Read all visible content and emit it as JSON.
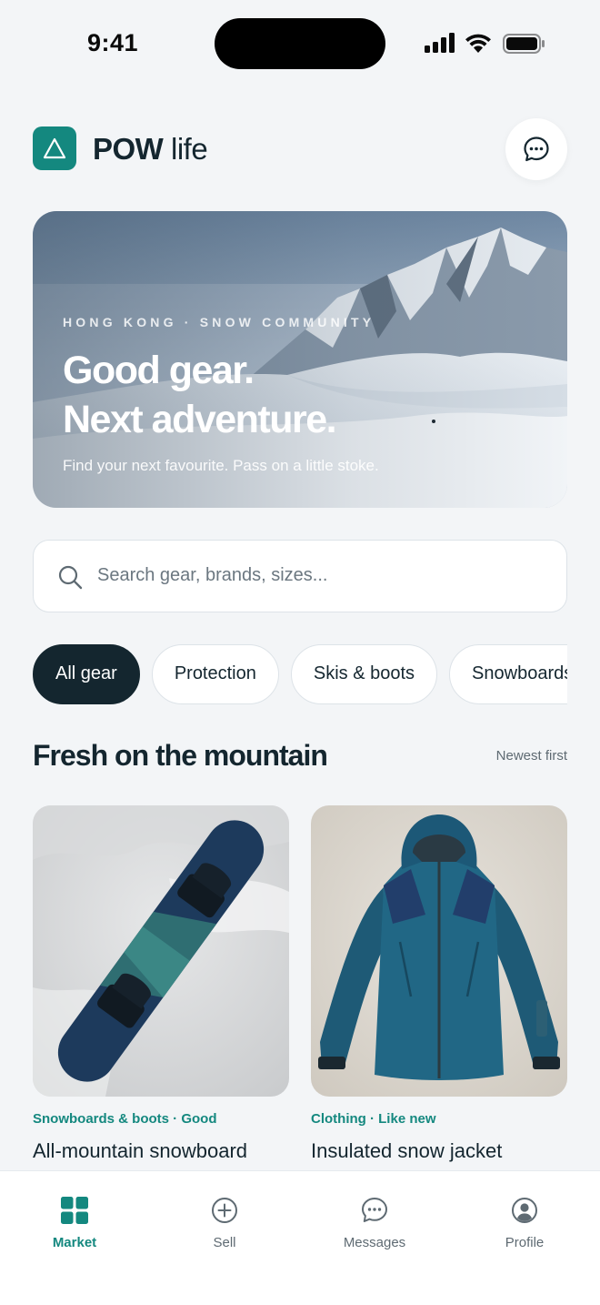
{
  "status_bar": {
    "time": "9:41"
  },
  "header": {
    "brand_strong": "POW",
    "brand_light": "life"
  },
  "hero": {
    "kicker": "HONG KONG · SNOW COMMUNITY",
    "title_line1": "Good gear.",
    "title_line2": "Next adventure.",
    "subtitle": "Find your next favourite. Pass on a little stoke."
  },
  "search": {
    "placeholder": "Search gear, brands, sizes..."
  },
  "chips": [
    {
      "label": "All gear",
      "active": true
    },
    {
      "label": "Protection",
      "active": false
    },
    {
      "label": "Skis & boots",
      "active": false
    },
    {
      "label": "Snowboards",
      "active": false
    }
  ],
  "section": {
    "title": "Fresh on the mountain",
    "sort": "Newest first"
  },
  "products": [
    {
      "meta": "Snowboards & boots · Good",
      "title": "All-mountain snowboard",
      "icon": "snowboard-photo"
    },
    {
      "meta": "Clothing · Like new",
      "title": "Insulated snow jacket",
      "icon": "jacket-photo"
    }
  ],
  "tabs": [
    {
      "label": "Market",
      "icon": "grid-icon",
      "active": true
    },
    {
      "label": "Sell",
      "icon": "plus-circle-icon",
      "active": false
    },
    {
      "label": "Messages",
      "icon": "chat-icon",
      "active": false
    },
    {
      "label": "Profile",
      "icon": "user-circle-icon",
      "active": false
    }
  ],
  "colors": {
    "accent": "#14887f",
    "ink": "#14262f",
    "background": "#f3f5f7"
  }
}
